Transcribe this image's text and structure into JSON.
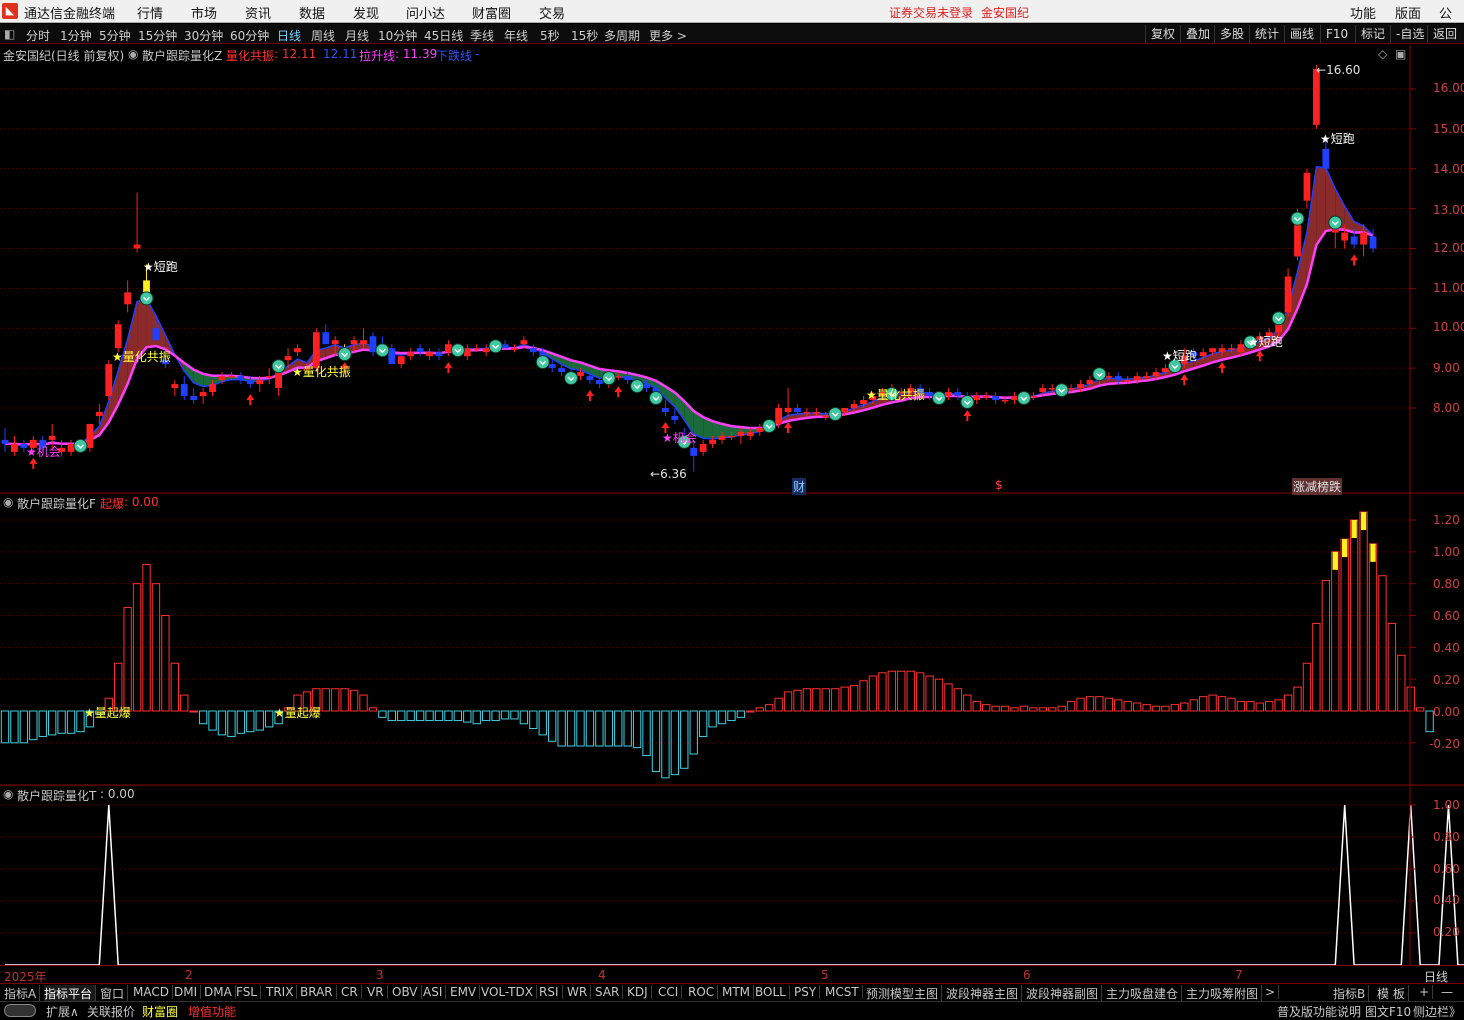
{
  "app": {
    "title": "通达信金融终端",
    "menu": [
      "行情",
      "市场",
      "资讯",
      "数据",
      "发现",
      "问小达",
      "财富圈",
      "交易"
    ],
    "login_status": "证券交易未登录",
    "stock_name": "金安国纪",
    "right_menu": [
      "功能",
      "版面",
      "公式"
    ]
  },
  "toolbar": {
    "periods": [
      "分时",
      "1分钟",
      "5分钟",
      "15分钟",
      "30分钟",
      "60分钟",
      "日线",
      "周线",
      "月线",
      "10分钟",
      "45日线",
      "季线",
      "年线",
      "5秒",
      "15秒",
      "多周期",
      "更多 >"
    ],
    "active_period": "日线",
    "right_buttons": [
      "复权",
      "叠加",
      "多股",
      "统计",
      "画线",
      "F10",
      "-自选",
      "返回"
    ]
  },
  "main_panel": {
    "header_title": "金安国纪(日线 前复权)",
    "indicator_name": "散户跟踪量化Z",
    "legend": [
      {
        "label": "量化共振",
        "value": ": 12.11",
        "color": "#ff3030"
      },
      {
        "label": "",
        "value": "12.11",
        "color": "#3050ff"
      },
      {
        "label": "拉升线",
        "value": ": 11.39",
        "color": "#ff40ff"
      },
      {
        "label": "下跌线",
        "value": "-",
        "color": "#3050ff"
      }
    ],
    "price_ticks": [
      "16.00",
      "15.00",
      "14.00",
      "13.00",
      "12.00",
      "11.00",
      "10.00",
      "9.00",
      "8.00"
    ],
    "annotations": {
      "high_label": "16.60",
      "low_label": "6.36",
      "short_run": "短跑",
      "resonance": "量化共振",
      "chance": "机会",
      "finance_mark": "财",
      "dollar_mark": "$",
      "limit_mark": "涨减榜跌"
    }
  },
  "panel_f": {
    "title": "散户跟踪量化F",
    "legend_label": "起爆",
    "legend_value": ": 0.00",
    "ticks": [
      "1.20",
      "1.00",
      "0.80",
      "0.60",
      "0.40",
      "0.20",
      "0.00",
      "-0.20"
    ],
    "marker_label": "量起爆"
  },
  "panel_t": {
    "title": "散户跟踪量化T",
    "legend_value": ": 0.00",
    "ticks": [
      "1.00",
      "0.80",
      "0.60",
      "0.40",
      "0.20"
    ]
  },
  "x_axis": {
    "labels": [
      "2025年",
      "2",
      "3",
      "4",
      "5",
      "6",
      "7"
    ],
    "period_label": "日线"
  },
  "bottom_tabs": {
    "row1": [
      "指标A",
      "指标平台",
      "窗口",
      "MACD",
      "DMI",
      "DMA",
      "FSL",
      "TRIX",
      "BRAR",
      "CR",
      "VR",
      "OBV",
      "ASI",
      "EMV",
      "VOL-TDX",
      "RSI",
      "WR",
      "SAR",
      "KDJ",
      "CCI",
      "ROC",
      "MTM",
      "BOLL",
      "PSY",
      "MCST",
      "预测模型主图",
      "波段神器主图",
      "波段神器副图",
      "主力吸盘建仓",
      "主力吸筹附图",
      ">"
    ],
    "row1_right": [
      "指标B",
      "模 板",
      "+",
      "—"
    ],
    "row2": [
      "扩展∧",
      "关联报价",
      "财富圈",
      "增值功能"
    ],
    "row2_right": [
      "普及版功能说明",
      "图文F10",
      "侧边栏》"
    ]
  },
  "chart_data": [
    {
      "type": "candlestick",
      "title": "金安国纪(日线 前复权)",
      "ylim": [
        6.0,
        16.9
      ],
      "ohlc": [
        [
          7.2,
          7.5,
          6.9,
          7.1
        ],
        [
          6.9,
          7.3,
          6.8,
          7.1
        ],
        [
          7.1,
          7.2,
          6.9,
          7.0
        ],
        [
          7.0,
          7.3,
          6.9,
          7.2
        ],
        [
          7.2,
          7.3,
          6.9,
          7.0
        ],
        [
          7.2,
          7.6,
          7.0,
          7.3
        ],
        [
          6.9,
          7.2,
          6.8,
          7.0
        ],
        [
          6.9,
          7.2,
          6.8,
          7.1
        ],
        [
          7.0,
          7.2,
          6.9,
          7.1
        ],
        [
          7.0,
          7.6,
          6.9,
          7.6
        ],
        [
          7.8,
          8.1,
          7.6,
          7.9
        ],
        [
          8.3,
          9.2,
          8.2,
          9.1
        ],
        [
          9.5,
          10.2,
          9.4,
          10.1
        ],
        [
          10.6,
          11.2,
          10.4,
          10.9
        ],
        [
          12.0,
          13.4,
          11.9,
          12.1
        ],
        [
          11.2,
          11.6,
          10.8,
          10.8
        ],
        [
          10.0,
          10.3,
          9.7,
          9.7
        ],
        [
          9.2,
          9.4,
          9.0,
          9.1
        ],
        [
          8.5,
          8.7,
          8.3,
          8.6
        ],
        [
          8.6,
          8.8,
          8.2,
          8.3
        ],
        [
          8.3,
          8.5,
          8.1,
          8.2
        ],
        [
          8.3,
          8.5,
          8.1,
          8.4
        ],
        [
          8.4,
          8.7,
          8.3,
          8.6
        ],
        [
          8.7,
          8.9,
          8.6,
          8.8
        ],
        [
          8.8,
          8.9,
          8.7,
          8.8
        ],
        [
          8.8,
          8.9,
          8.6,
          8.7
        ],
        [
          8.7,
          8.8,
          8.5,
          8.6
        ],
        [
          8.6,
          8.8,
          8.4,
          8.7
        ],
        [
          8.8,
          9.0,
          8.6,
          8.8
        ],
        [
          8.5,
          9.2,
          8.3,
          9.1
        ],
        [
          9.2,
          9.5,
          9.0,
          9.3
        ],
        [
          9.4,
          9.6,
          9.3,
          9.5
        ],
        [
          9.0,
          9.1,
          8.9,
          9.0
        ],
        [
          9.0,
          10.0,
          8.9,
          9.9
        ],
        [
          9.9,
          10.1,
          9.6,
          9.6
        ],
        [
          9.6,
          9.8,
          9.3,
          9.7
        ],
        [
          9.5,
          9.6,
          9.3,
          9.4
        ],
        [
          9.6,
          9.8,
          9.4,
          9.7
        ],
        [
          9.6,
          10.0,
          9.5,
          9.7
        ],
        [
          9.8,
          9.9,
          9.3,
          9.4
        ],
        [
          9.6,
          9.8,
          9.4,
          9.5
        ],
        [
          9.5,
          9.6,
          9.1,
          9.1
        ],
        [
          9.1,
          9.3,
          9.0,
          9.3
        ],
        [
          9.3,
          9.5,
          9.2,
          9.4
        ],
        [
          9.5,
          9.6,
          9.3,
          9.4
        ],
        [
          9.3,
          9.5,
          9.2,
          9.4
        ],
        [
          9.4,
          9.5,
          9.2,
          9.3
        ],
        [
          9.4,
          9.7,
          9.3,
          9.6
        ],
        [
          9.5,
          9.6,
          9.3,
          9.5
        ],
        [
          9.3,
          9.6,
          9.2,
          9.5
        ],
        [
          9.5,
          9.6,
          9.4,
          9.5
        ],
        [
          9.4,
          9.6,
          9.3,
          9.5
        ],
        [
          9.6,
          9.7,
          9.5,
          9.6
        ],
        [
          9.6,
          9.7,
          9.5,
          9.5
        ],
        [
          9.5,
          9.6,
          9.4,
          9.5
        ],
        [
          9.6,
          9.8,
          9.5,
          9.7
        ],
        [
          9.5,
          9.6,
          9.3,
          9.4
        ],
        [
          9.4,
          9.5,
          9.2,
          9.2
        ],
        [
          9.1,
          9.2,
          8.9,
          9.0
        ],
        [
          9.0,
          9.1,
          8.8,
          8.9
        ],
        [
          8.9,
          9.0,
          8.7,
          8.8
        ],
        [
          8.8,
          9.0,
          8.7,
          8.9
        ],
        [
          8.8,
          8.9,
          8.6,
          8.7
        ],
        [
          8.7,
          8.8,
          8.5,
          8.6
        ],
        [
          8.6,
          8.9,
          8.5,
          8.8
        ],
        [
          8.8,
          8.9,
          8.7,
          8.8
        ],
        [
          8.8,
          8.9,
          8.6,
          8.7
        ],
        [
          8.7,
          8.8,
          8.5,
          8.6
        ],
        [
          8.6,
          8.7,
          8.4,
          8.5
        ],
        [
          8.5,
          8.6,
          8.2,
          8.3
        ],
        [
          8.0,
          8.2,
          7.8,
          7.9
        ],
        [
          7.8,
          8.0,
          7.6,
          7.7
        ],
        [
          7.3,
          7.5,
          7.1,
          7.2
        ],
        [
          7.0,
          7.2,
          6.4,
          6.8
        ],
        [
          6.9,
          7.2,
          6.8,
          7.1
        ],
        [
          7.1,
          7.3,
          7.0,
          7.2
        ],
        [
          7.2,
          7.4,
          7.1,
          7.3
        ],
        [
          7.3,
          7.4,
          7.2,
          7.3
        ],
        [
          7.3,
          7.5,
          7.1,
          7.4
        ],
        [
          7.3,
          7.5,
          7.2,
          7.4
        ],
        [
          7.4,
          7.6,
          7.3,
          7.5
        ],
        [
          7.5,
          7.7,
          7.4,
          7.6
        ],
        [
          7.6,
          8.1,
          7.5,
          8.0
        ],
        [
          7.9,
          8.5,
          7.8,
          8.0
        ],
        [
          8.0,
          8.1,
          7.8,
          7.9
        ],
        [
          7.9,
          8.0,
          7.8,
          7.9
        ],
        [
          7.9,
          8.0,
          7.8,
          7.9
        ],
        [
          7.8,
          7.9,
          7.7,
          7.8
        ],
        [
          7.8,
          8.0,
          7.7,
          7.9
        ],
        [
          7.9,
          8.0,
          7.8,
          8.0
        ],
        [
          8.0,
          8.2,
          7.9,
          8.1
        ],
        [
          8.1,
          8.3,
          8.0,
          8.2
        ],
        [
          8.2,
          8.4,
          8.1,
          8.3
        ],
        [
          8.3,
          8.5,
          8.2,
          8.4
        ],
        [
          8.4,
          8.6,
          8.3,
          8.4
        ],
        [
          8.4,
          8.5,
          8.3,
          8.4
        ],
        [
          8.4,
          8.6,
          8.3,
          8.5
        ],
        [
          8.5,
          8.6,
          8.3,
          8.4
        ],
        [
          8.4,
          8.5,
          8.2,
          8.3
        ],
        [
          8.3,
          8.4,
          8.2,
          8.3
        ],
        [
          8.3,
          8.5,
          8.2,
          8.4
        ],
        [
          8.4,
          8.5,
          8.2,
          8.3
        ],
        [
          8.3,
          8.4,
          8.1,
          8.2
        ],
        [
          8.2,
          8.4,
          8.1,
          8.3
        ],
        [
          8.3,
          8.4,
          8.2,
          8.3
        ],
        [
          8.3,
          8.4,
          8.1,
          8.2
        ],
        [
          8.2,
          8.3,
          8.1,
          8.2
        ],
        [
          8.2,
          8.4,
          8.1,
          8.3
        ],
        [
          8.3,
          8.4,
          8.2,
          8.3
        ],
        [
          8.3,
          8.4,
          8.2,
          8.3
        ],
        [
          8.4,
          8.6,
          8.3,
          8.5
        ],
        [
          8.5,
          8.6,
          8.4,
          8.5
        ],
        [
          8.5,
          8.6,
          8.4,
          8.5
        ],
        [
          8.5,
          8.6,
          8.4,
          8.5
        ],
        [
          8.5,
          8.7,
          8.4,
          8.6
        ],
        [
          8.6,
          8.8,
          8.5,
          8.7
        ],
        [
          8.7,
          9.0,
          8.6,
          8.9
        ],
        [
          8.8,
          8.9,
          8.7,
          8.8
        ],
        [
          8.8,
          8.9,
          8.6,
          8.7
        ],
        [
          8.7,
          8.8,
          8.6,
          8.7
        ],
        [
          8.7,
          8.9,
          8.6,
          8.8
        ],
        [
          8.8,
          8.9,
          8.7,
          8.8
        ],
        [
          8.8,
          9.0,
          8.7,
          8.9
        ],
        [
          8.9,
          9.1,
          8.8,
          9.0
        ],
        [
          9.0,
          9.2,
          8.9,
          9.1
        ],
        [
          9.1,
          9.5,
          9.0,
          9.3
        ],
        [
          9.4,
          9.5,
          9.2,
          9.3
        ],
        [
          9.3,
          9.5,
          9.2,
          9.4
        ],
        [
          9.4,
          9.5,
          9.3,
          9.5
        ],
        [
          9.4,
          9.6,
          9.3,
          9.5
        ],
        [
          9.5,
          9.6,
          9.4,
          9.5
        ],
        [
          9.4,
          9.7,
          9.3,
          9.6
        ],
        [
          9.6,
          9.8,
          9.5,
          9.7
        ],
        [
          9.7,
          9.9,
          9.6,
          9.8
        ],
        [
          9.8,
          10.0,
          9.7,
          9.9
        ],
        [
          9.9,
          10.4,
          9.8,
          10.3
        ],
        [
          10.4,
          11.5,
          10.3,
          11.3
        ],
        [
          11.8,
          13.0,
          11.7,
          12.8
        ],
        [
          13.2,
          14.0,
          13.0,
          13.9
        ],
        [
          15.1,
          16.6,
          15.0,
          16.5
        ],
        [
          14.5,
          14.8,
          13.9,
          14.0
        ],
        [
          12.4,
          12.8,
          12.0,
          12.7
        ],
        [
          12.2,
          12.6,
          12.0,
          12.4
        ],
        [
          12.3,
          12.5,
          12.0,
          12.1
        ],
        [
          12.1,
          12.6,
          11.8,
          12.4
        ],
        [
          12.3,
          12.5,
          11.9,
          12.0
        ]
      ],
      "series": [
        {
          "name": "拉升线",
          "last": 11.39
        }
      ]
    },
    {
      "type": "bar",
      "title": "散户跟踪量化F",
      "ylim": [
        -0.3,
        1.3
      ],
      "values": [
        -0.2,
        -0.2,
        -0.2,
        -0.18,
        -0.16,
        -0.15,
        -0.14,
        -0.14,
        -0.13,
        -0.1,
        -0.02,
        0.08,
        0.3,
        0.65,
        0.8,
        0.92,
        0.8,
        0.6,
        0.3,
        0.1,
        0.0,
        -0.08,
        -0.12,
        -0.15,
        -0.16,
        -0.14,
        -0.13,
        -0.12,
        -0.1,
        -0.08,
        0.02,
        0.1,
        0.12,
        0.14,
        0.14,
        0.14,
        0.14,
        0.13,
        0.1,
        0.02,
        -0.04,
        -0.06,
        -0.06,
        -0.06,
        -0.06,
        -0.06,
        -0.06,
        -0.06,
        -0.06,
        -0.07,
        -0.08,
        -0.06,
        -0.06,
        -0.05,
        -0.05,
        -0.08,
        -0.11,
        -0.15,
        -0.19,
        -0.22,
        -0.22,
        -0.22,
        -0.22,
        -0.22,
        -0.22,
        -0.22,
        -0.22,
        -0.23,
        -0.28,
        -0.38,
        -0.42,
        -0.4,
        -0.36,
        -0.27,
        -0.16,
        -0.1,
        -0.08,
        -0.06,
        -0.04,
        0.0,
        0.02,
        0.04,
        0.08,
        0.12,
        0.13,
        0.14,
        0.14,
        0.14,
        0.14,
        0.15,
        0.16,
        0.19,
        0.22,
        0.24,
        0.25,
        0.25,
        0.25,
        0.24,
        0.22,
        0.2,
        0.17,
        0.14,
        0.1,
        0.06,
        0.04,
        0.03,
        0.03,
        0.02,
        0.03,
        0.02,
        0.02,
        0.02,
        0.03,
        0.06,
        0.08,
        0.09,
        0.09,
        0.08,
        0.07,
        0.06,
        0.05,
        0.04,
        0.03,
        0.03,
        0.04,
        0.05,
        0.07,
        0.09,
        0.1,
        0.09,
        0.08,
        0.06,
        0.06,
        0.05,
        0.06,
        0.07,
        0.1,
        0.15,
        0.3,
        0.55,
        0.82,
        1.0,
        1.08,
        1.2,
        1.25,
        1.05,
        0.85,
        0.55,
        0.35,
        0.15,
        0.02,
        -0.13
      ]
    },
    {
      "type": "line",
      "title": "散户跟踪量化T",
      "ylim": [
        0,
        1.05
      ],
      "values": [
        0,
        0,
        0,
        0,
        0,
        0,
        0,
        0,
        0,
        0,
        0,
        1,
        0,
        0,
        0,
        0,
        0,
        0,
        0,
        0,
        0,
        0,
        0,
        0,
        0,
        0,
        0,
        0,
        0,
        0,
        0,
        0,
        0,
        0,
        0,
        0,
        0,
        0,
        0,
        0,
        0,
        0,
        0,
        0,
        0,
        0,
        0,
        0,
        0,
        0,
        0,
        0,
        0,
        0,
        0,
        0,
        0,
        0,
        0,
        0,
        0,
        0,
        0,
        0,
        0,
        0,
        0,
        0,
        0,
        0,
        0,
        0,
        0,
        0,
        0,
        0,
        0,
        0,
        0,
        0,
        0,
        0,
        0,
        0,
        0,
        0,
        0,
        0,
        0,
        0,
        0,
        0,
        0,
        0,
        0,
        0,
        0,
        0,
        0,
        0,
        0,
        0,
        0,
        0,
        0,
        0,
        0,
        0,
        0,
        0,
        0,
        0,
        0,
        0,
        0,
        0,
        0,
        0,
        0,
        0,
        0,
        0,
        0,
        0,
        0,
        0,
        0,
        0,
        0,
        0,
        0,
        0,
        0,
        0,
        0,
        0,
        0,
        0,
        0,
        0,
        0,
        0,
        1,
        0,
        0,
        0,
        0,
        0,
        0,
        1,
        0,
        0,
        0,
        1,
        0,
        0,
        0
      ]
    }
  ]
}
